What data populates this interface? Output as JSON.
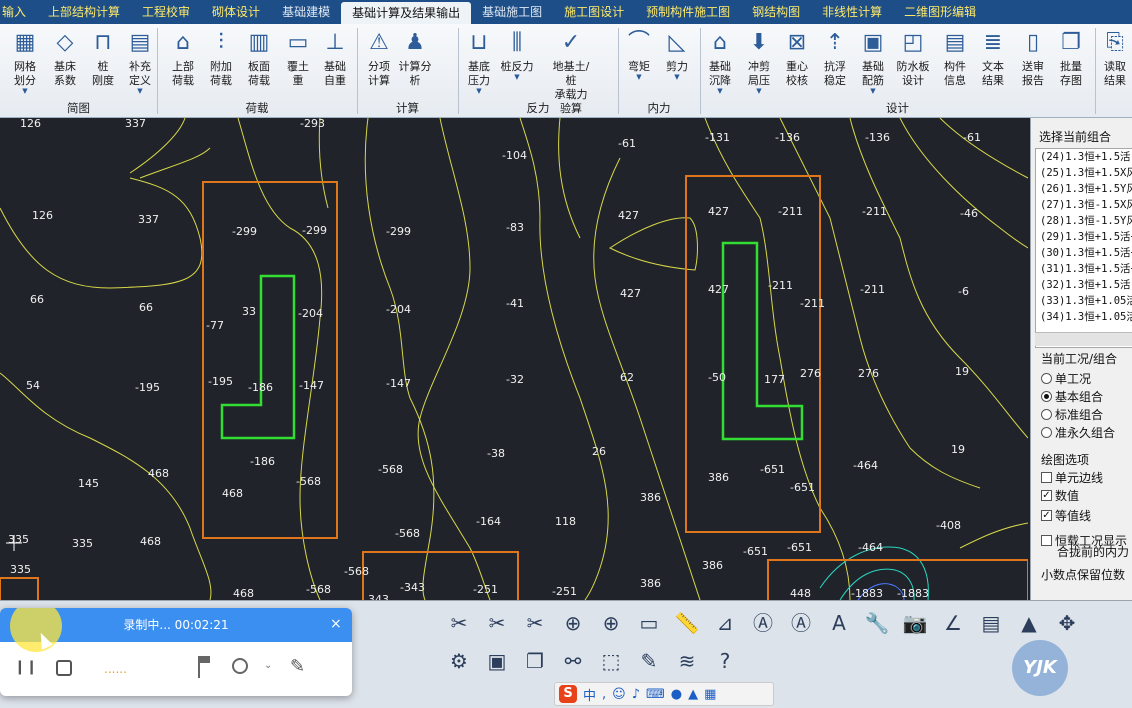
{
  "tabs": [
    {
      "label": "输入",
      "style": "yellow"
    },
    {
      "label": "上部结构计算",
      "style": "yellow"
    },
    {
      "label": "工程校审",
      "style": "yellow"
    },
    {
      "label": "砌体设计",
      "style": "yellow"
    },
    {
      "label": "基础建模",
      "style": "plain"
    },
    {
      "label": "基础计算及结果输出",
      "style": "active"
    },
    {
      "label": "基础施工图",
      "style": "plain"
    },
    {
      "label": "施工图设计",
      "style": "yellow"
    },
    {
      "label": "预制构件施工图",
      "style": "yellow"
    },
    {
      "label": "钢结构图",
      "style": "yellow"
    },
    {
      "label": "非线性计算",
      "style": "yellow"
    },
    {
      "label": "二维图形编辑",
      "style": "yellow"
    }
  ],
  "ribbon": {
    "buttons": [
      {
        "label": "网格\n划分",
        "icon": "grid-mesh-icon",
        "dropdown": true
      },
      {
        "label": "基床\n系数",
        "icon": "bed-coefficient-icon",
        "dropdown": false
      },
      {
        "label": "桩\n刚度",
        "icon": "pile-stiffness-icon",
        "dropdown": false
      },
      {
        "label": "补充\n定义",
        "icon": "supplement-define-icon",
        "dropdown": true
      },
      {
        "label": "上部\n荷载",
        "icon": "upper-load-icon",
        "dropdown": false
      },
      {
        "label": "附加\n荷载",
        "icon": "additional-load-icon",
        "dropdown": false
      },
      {
        "label": "板面\n荷载",
        "icon": "slab-load-icon",
        "dropdown": false
      },
      {
        "label": "覆土\n重",
        "icon": "soil-cover-icon",
        "dropdown": false
      },
      {
        "label": "基础\n自重",
        "icon": "foundation-weight-icon",
        "dropdown": false
      },
      {
        "label": "分项\n计算",
        "icon": "item-calc-icon",
        "dropdown": false
      },
      {
        "label": "计算分析",
        "icon": "calc-analysis-icon",
        "dropdown": false
      },
      {
        "label": "基底\n压力",
        "icon": "base-pressure-icon",
        "dropdown": true
      },
      {
        "label": "桩反力",
        "icon": "pile-reaction-icon",
        "dropdown": true
      },
      {
        "label": "地基土/桩\n承载力验算",
        "icon": "bearing-check-icon",
        "dropdown": false
      },
      {
        "label": "弯矩",
        "icon": "moment-icon",
        "dropdown": true
      },
      {
        "label": "剪力",
        "icon": "shear-icon",
        "dropdown": true
      },
      {
        "label": "基础\n沉降",
        "icon": "settlement-icon",
        "dropdown": true
      },
      {
        "label": "冲剪\n局压",
        "icon": "punching-icon",
        "dropdown": true
      },
      {
        "label": "重心\n校核",
        "icon": "centroid-check-icon",
        "dropdown": false
      },
      {
        "label": "抗浮\n稳定",
        "icon": "anti-float-icon",
        "dropdown": false
      },
      {
        "label": "基础\n配筋",
        "icon": "reinforcement-icon",
        "dropdown": true
      },
      {
        "label": "防水板\n设计",
        "icon": "waterproof-slab-icon",
        "dropdown": false
      },
      {
        "label": "构件\n信息",
        "icon": "member-info-icon",
        "dropdown": false
      },
      {
        "label": "文本\n结果",
        "icon": "text-result-icon",
        "dropdown": false
      },
      {
        "label": "送审\n报告",
        "icon": "review-report-icon",
        "dropdown": false
      },
      {
        "label": "批量\n存图",
        "icon": "batch-save-icon",
        "dropdown": false
      },
      {
        "label": "读取\n结果",
        "icon": "read-result-icon",
        "dropdown": false
      }
    ],
    "groups": [
      "简图",
      "荷载",
      "计算",
      "反力",
      "内力",
      "设计"
    ]
  },
  "panel": {
    "title": "选择当前组合",
    "combos": [
      "(24)1.3恒+1.5活",
      "(25)1.3恒+1.5X风",
      "(26)1.3恒+1.5Y风",
      "(27)1.3恒-1.5X风",
      "(28)1.3恒-1.5Y风",
      "(29)1.3恒+1.5活+",
      "(30)1.3恒+1.5活+",
      "(31)1.3恒+1.5活+",
      "(32)1.3恒+1.5活-",
      "(33)1.3恒+1.05活",
      "(34)1.3恒+1.05活"
    ],
    "case_title": "当前工况/组合",
    "cases": [
      {
        "label": "单工况",
        "selected": false
      },
      {
        "label": "基本组合",
        "selected": true
      },
      {
        "label": "标准组合",
        "selected": false
      },
      {
        "label": "准永久组合",
        "selected": false
      }
    ],
    "draw_title": "绘图选项",
    "options": [
      {
        "label": "单元边线",
        "checked": false
      },
      {
        "label": "数值",
        "checked": true
      },
      {
        "label": "等值线",
        "checked": true
      },
      {
        "label": "恒载工况显示",
        "checked": false
      }
    ],
    "option_extra": "合拢前的内力",
    "decimal_label": "小数点保留位数"
  },
  "canvas_values": [
    {
      "v": "126"
    },
    {
      "v": "337"
    },
    {
      "v": "-293"
    },
    {
      "v": "-131"
    },
    {
      "v": "-136"
    },
    {
      "v": "-136"
    },
    {
      "v": "-61"
    },
    {
      "v": "126"
    },
    {
      "v": "337"
    },
    {
      "v": "-299"
    },
    {
      "v": "-299"
    },
    {
      "v": "-299"
    },
    {
      "v": "-104"
    },
    {
      "v": "-61"
    },
    {
      "v": "-83"
    },
    {
      "v": "427"
    },
    {
      "v": "427"
    },
    {
      "v": "-211"
    },
    {
      "v": "-211"
    },
    {
      "v": "-46"
    },
    {
      "v": "66"
    },
    {
      "v": "66"
    },
    {
      "v": "33"
    },
    {
      "v": "-77"
    },
    {
      "v": "-204"
    },
    {
      "v": "-204"
    },
    {
      "v": "-41"
    },
    {
      "v": "427"
    },
    {
      "v": "427"
    },
    {
      "v": "-211"
    },
    {
      "v": "-211"
    },
    {
      "v": "-211"
    },
    {
      "v": "-6"
    },
    {
      "v": "54"
    },
    {
      "v": "-195"
    },
    {
      "v": "-195"
    },
    {
      "v": "-186"
    },
    {
      "v": "-147"
    },
    {
      "v": "-147"
    },
    {
      "v": "-32"
    },
    {
      "v": "62"
    },
    {
      "v": "-50"
    },
    {
      "v": "177"
    },
    {
      "v": "276"
    },
    {
      "v": "276"
    },
    {
      "v": "19"
    },
    {
      "v": "-38"
    },
    {
      "v": "26"
    },
    {
      "v": "-186"
    },
    {
      "v": "-568"
    },
    {
      "v": "-464"
    },
    {
      "v": "19"
    },
    {
      "v": "468"
    },
    {
      "v": "145"
    },
    {
      "v": "468"
    },
    {
      "v": "-568"
    },
    {
      "v": "386"
    },
    {
      "v": "-651"
    },
    {
      "v": "-651"
    },
    {
      "v": "386"
    },
    {
      "v": "-164"
    },
    {
      "v": "118"
    },
    {
      "v": "-408"
    },
    {
      "v": "335"
    },
    {
      "v": "335"
    },
    {
      "v": "468"
    },
    {
      "v": "-568"
    },
    {
      "v": "386"
    },
    {
      "v": "-651"
    },
    {
      "v": "-651"
    },
    {
      "v": "-464"
    },
    {
      "v": "-568"
    },
    {
      "v": "-343"
    },
    {
      "v": "-251"
    },
    {
      "v": "-251"
    },
    {
      "v": "386"
    },
    {
      "v": "448"
    },
    {
      "v": "-1883"
    },
    {
      "v": "-1883"
    },
    {
      "v": "468"
    },
    {
      "v": "-568"
    },
    {
      "v": "343"
    },
    {
      "v": "335"
    }
  ],
  "colors": {
    "contour": "#d8d84a",
    "wall": "#e0761c",
    "column": "#33dd33",
    "canvas": "#202329",
    "tabbar": "#1d4e87"
  },
  "recorder": {
    "status": "录制中... 00:02:21",
    "progress": "......"
  },
  "ime": {
    "label": "中"
  },
  "watermark": {
    "text": "YJK"
  }
}
